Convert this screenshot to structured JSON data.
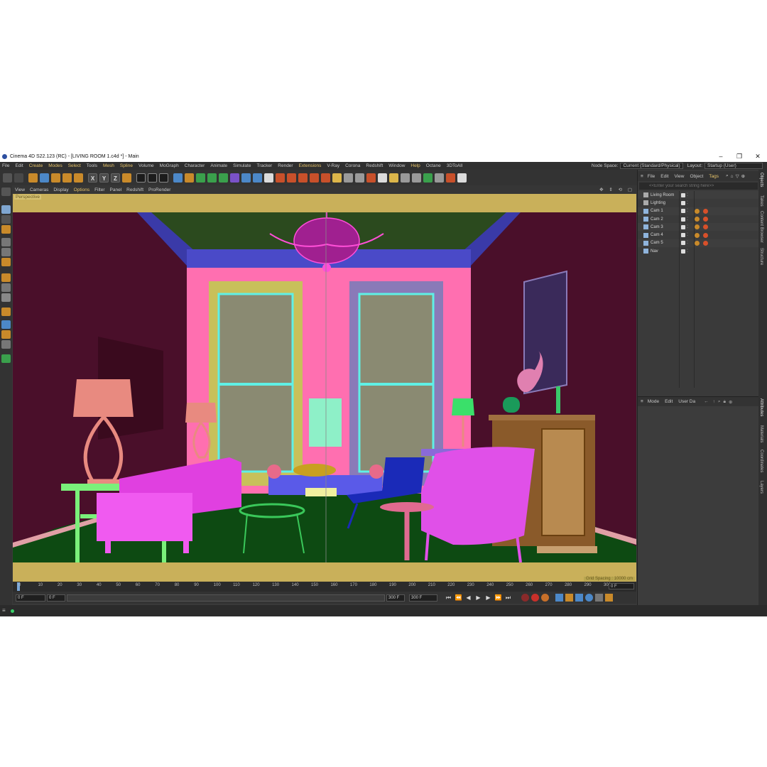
{
  "window": {
    "title": "Cinema 4D S22.123 (RC) - [LIVING ROOM 1.c4d *] - Main",
    "minimize": "–",
    "maximize": "❐",
    "close": "✕"
  },
  "menubar": {
    "items": [
      {
        "label": "File"
      },
      {
        "label": "Edit"
      },
      {
        "label": "Create"
      },
      {
        "label": "Modes"
      },
      {
        "label": "Select"
      },
      {
        "label": "Tools"
      },
      {
        "label": "Mesh"
      },
      {
        "label": "Spline"
      },
      {
        "label": "Volume"
      },
      {
        "label": "MoGraph"
      },
      {
        "label": "Character"
      },
      {
        "label": "Animate"
      },
      {
        "label": "Simulate"
      },
      {
        "label": "Tracker"
      },
      {
        "label": "Render"
      },
      {
        "label": "Extensions"
      },
      {
        "label": "V-Ray"
      },
      {
        "label": "Corona"
      },
      {
        "label": "Redshift"
      },
      {
        "label": "Window"
      },
      {
        "label": "Help"
      },
      {
        "label": "Octane"
      },
      {
        "label": "3DToAll"
      }
    ],
    "node_space_label": "Node Space:",
    "node_space_value": "Current (Standard/Physical)",
    "layout_label": "Layout:",
    "layout_value": "Startup (User)"
  },
  "toolbar": {
    "axis_x": "X",
    "axis_y": "Y",
    "axis_z": "Z"
  },
  "viewport_menu": {
    "items": [
      {
        "label": "View"
      },
      {
        "label": "Cameras"
      },
      {
        "label": "Display"
      },
      {
        "label": "Options"
      },
      {
        "label": "Filter"
      },
      {
        "label": "Panel"
      },
      {
        "label": "Redshift"
      },
      {
        "label": "ProRender"
      }
    ],
    "nav_icons": "✥ ⇕ ⟲ ▢"
  },
  "viewport": {
    "label": "Perspective",
    "grid_spacing": "Grid Spacing : 10000 cm"
  },
  "timeline": {
    "ticks": [
      "0",
      "10",
      "20",
      "30",
      "40",
      "50",
      "60",
      "70",
      "80",
      "90",
      "100",
      "110",
      "120",
      "130",
      "140",
      "150",
      "160",
      "170",
      "180",
      "190",
      "200",
      "210",
      "220",
      "230",
      "240",
      "250",
      "260",
      "270",
      "280",
      "290",
      "300"
    ],
    "current_frame": "0 F"
  },
  "transport": {
    "start_field": "0 F",
    "min_field": "0 F",
    "max_field": "300 F",
    "end_field": "300 F"
  },
  "object_manager": {
    "menu": [
      {
        "label": "File"
      },
      {
        "label": "Edit"
      },
      {
        "label": "View"
      },
      {
        "label": "Object"
      },
      {
        "label": "Tags"
      }
    ],
    "search_placeholder": "<<Enter your search string here>>",
    "objects": [
      {
        "name": "Living Room"
      },
      {
        "name": "Lighting"
      },
      {
        "name": "Cam 1"
      },
      {
        "name": "Cam 2"
      },
      {
        "name": "Cam 3"
      },
      {
        "name": "Cam 4"
      },
      {
        "name": "Cam 5"
      },
      {
        "name": "Nav"
      }
    ]
  },
  "attributes": {
    "menu": [
      {
        "label": "Mode"
      },
      {
        "label": "Edit"
      },
      {
        "label": "User Da"
      }
    ]
  },
  "side_tabs": {
    "top": [
      "Objects",
      "Takes",
      "Content Browser",
      "Structure"
    ],
    "bottom": [
      "Attributes",
      "Materials",
      "Coordinates",
      "Layers"
    ]
  },
  "colors": {
    "accent": "#e6c36a",
    "viewport_safe_frame": "#c9b05a"
  }
}
